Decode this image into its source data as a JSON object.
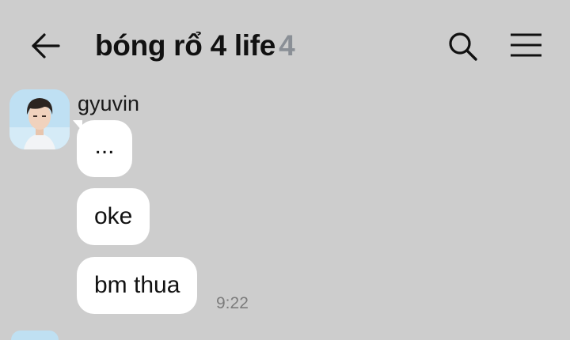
{
  "header": {
    "back_icon": "arrow-left-icon",
    "title": "bóng rổ 4 life",
    "member_count": "4",
    "search_icon": "search-icon",
    "menu_icon": "hamburger-menu-icon"
  },
  "messages": {
    "sender_name": "gyuvin",
    "items": [
      {
        "text": "..."
      },
      {
        "text": "oke"
      },
      {
        "text": "bm thua"
      }
    ],
    "time": "9:22"
  },
  "colors": {
    "background": "#cdcdcd",
    "bubble": "#ffffff",
    "member_count": "#8a8f96",
    "timestamp": "#7c7c7c"
  }
}
